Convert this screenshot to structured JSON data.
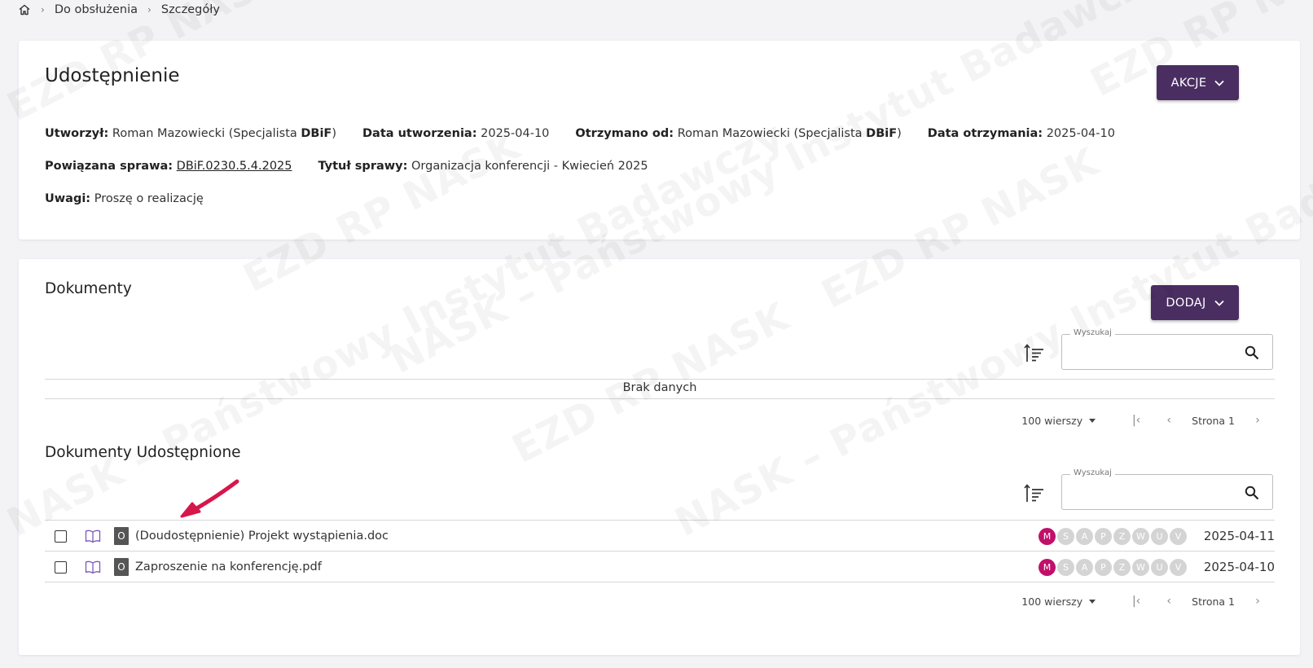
{
  "breadcrumb": {
    "items": [
      "Do obsłużenia",
      "Szczegóły"
    ]
  },
  "details": {
    "title": "Udostępnienie",
    "actions_label": "AKCJE",
    "created_by_label": "Utworzył:",
    "created_by_value": "Roman Mazowiecki (Specjalista ",
    "created_by_unit": "DBiF",
    "created_by_close": ")",
    "created_date_label": "Data utworzenia:",
    "created_date_value": "2025-04-10",
    "received_from_label": "Otrzymano od:",
    "received_from_value": "Roman Mazowiecki (Specjalista ",
    "received_from_unit": "DBiF",
    "received_from_close": ")",
    "received_date_label": "Data otrzymania:",
    "received_date_value": "2025-04-10",
    "related_case_label": "Powiązana sprawa:",
    "related_case_value": "DBiF.0230.5.4.2025",
    "case_title_label": "Tytuł sprawy:",
    "case_title_value": "Organizacja konferencji - Kwiecień 2025",
    "notes_label": "Uwagi:",
    "notes_value": "Proszę o realizację"
  },
  "documents": {
    "title": "Dokumenty",
    "add_label": "DODAJ",
    "search_label": "Wyszukaj",
    "no_data": "Brak danych",
    "rows_label": "100 wierszy",
    "page_label": "Strona 1"
  },
  "shared": {
    "title": "Dokumenty Udostępnione",
    "search_label": "Wyszukaj",
    "rows_label": "100 wierszy",
    "page_label": "Strona 1",
    "flag_letters": [
      "M",
      "S",
      "A",
      "P",
      "Z",
      "W",
      "U",
      "V"
    ],
    "items": [
      {
        "badge": "O",
        "name": "(Doudostępnienie) Projekt wystąpienia.doc",
        "date": "2025-04-11"
      },
      {
        "badge": "O",
        "name": "Zaproszenie na konferencję.pdf",
        "date": "2025-04-10"
      }
    ]
  },
  "watermark": {
    "line1": "NASK – Państwowy Instytut Badawczy",
    "line2": "EZD RP NASK"
  },
  "colors": {
    "accent": "#4a2e62",
    "flag_active": "#c0106a",
    "arrow": "#d6174a"
  }
}
